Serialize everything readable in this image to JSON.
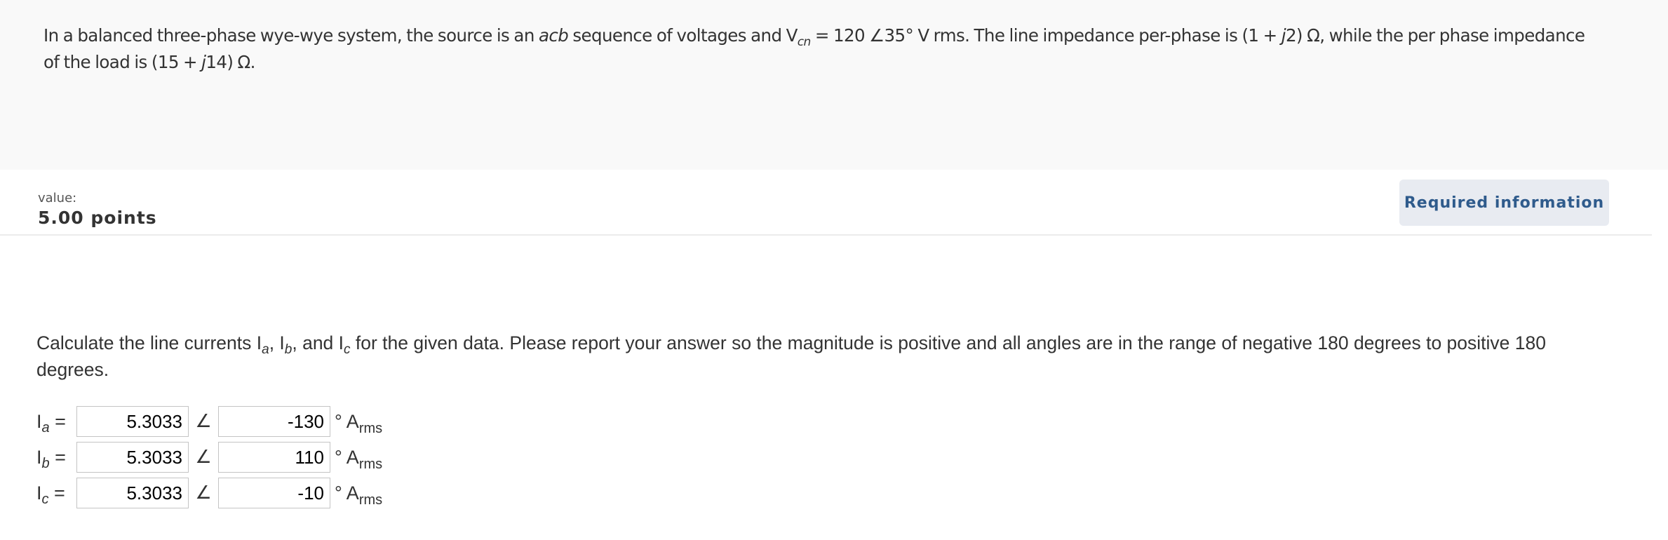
{
  "question": {
    "part1": "In a balanced three-phase wye-wye system, the source is an ",
    "seq": "acb",
    "part2": " sequence of voltages and V",
    "vsub": "cn",
    "part3": " = 120 ∠35° V rms. The line impedance per-phase is (1 + ",
    "j1": "j",
    "part4": "2) Ω, while the per phase impedance",
    "part5": "of the load is (15 + ",
    "j2": "j",
    "part6": "14) Ω."
  },
  "value": {
    "label": "value:",
    "points": "5.00 points"
  },
  "required_button": "Required information",
  "instruction": {
    "t1": "Calculate the line currents I",
    "s1": "a",
    "t2": ", I",
    "s2": "b",
    "t3": ", and I",
    "s3": "c",
    "t4": " for the given data. Please report your answer so the magnitude is positive and all angles are in the range of negative 180 degrees to positive 180",
    "t5": "degrees."
  },
  "answers": [
    {
      "label": "I",
      "sub": "a",
      "eq": " =",
      "magnitude": "5.3033",
      "angle": "-130",
      "unit_deg": "° A",
      "unit_sub": "rms"
    },
    {
      "label": "I",
      "sub": "b",
      "eq": " =",
      "magnitude": "5.3033",
      "angle": "110",
      "unit_deg": "° A",
      "unit_sub": "rms"
    },
    {
      "label": "I",
      "sub": "c",
      "eq": " =",
      "magnitude": "5.3033",
      "angle": "-10",
      "unit_deg": "° A",
      "unit_sub": "rms"
    }
  ],
  "angle_symbol": "∠"
}
